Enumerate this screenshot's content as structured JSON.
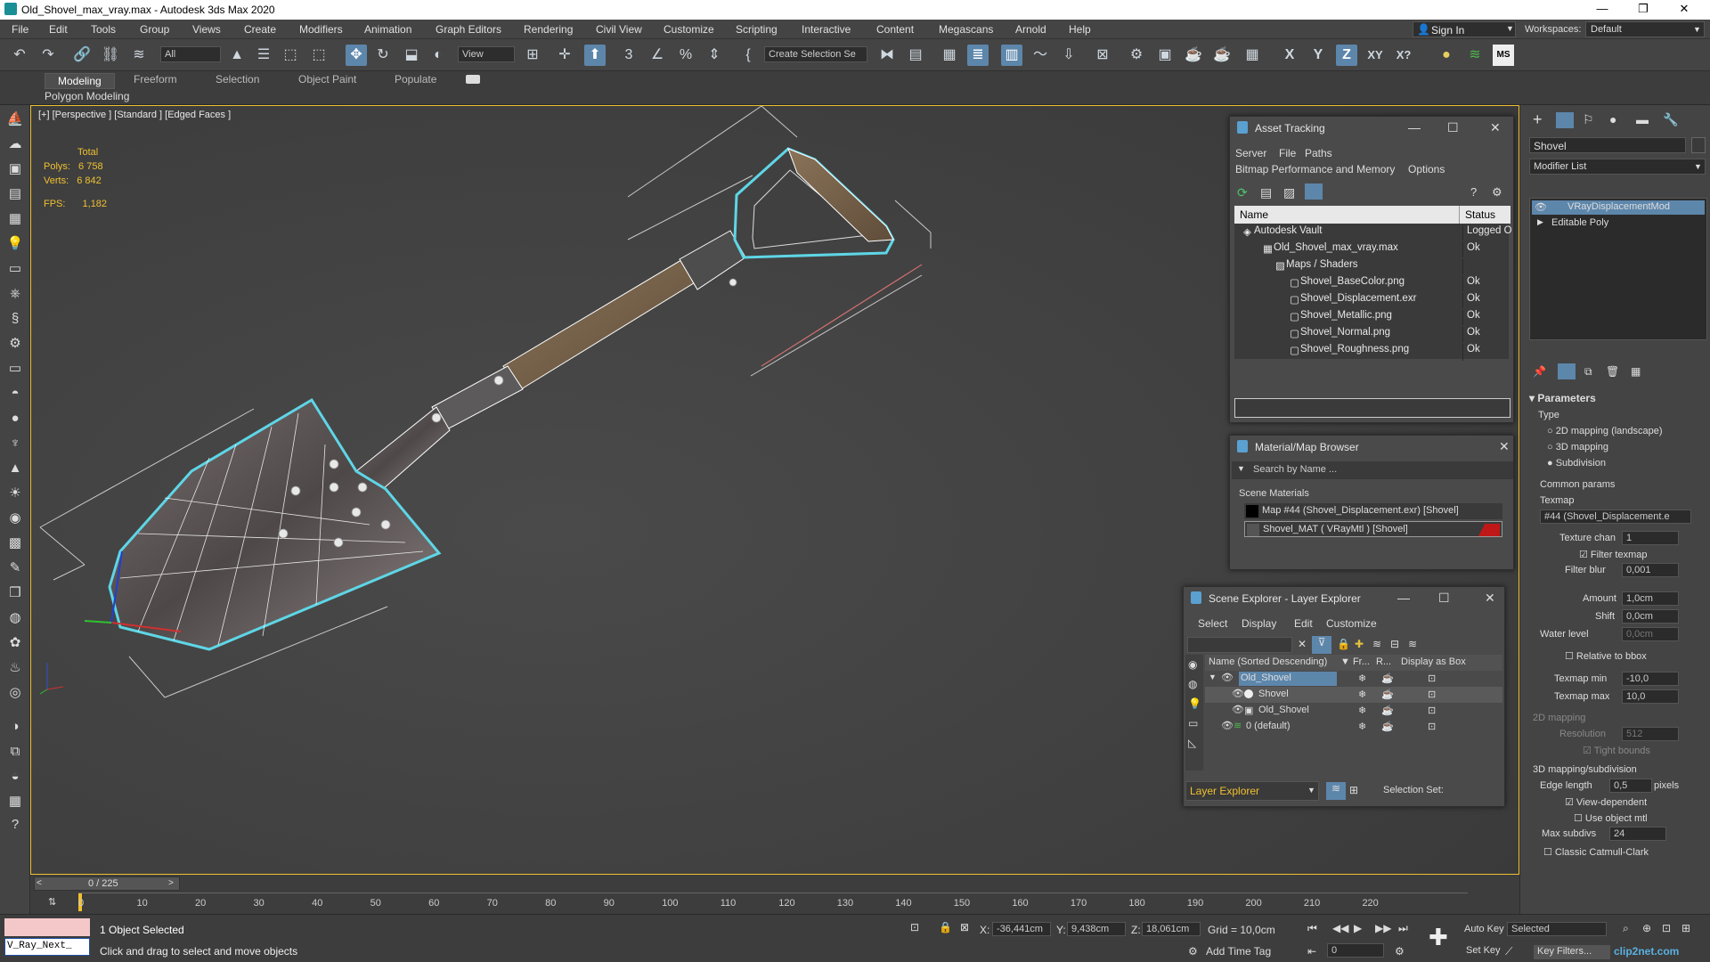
{
  "window": {
    "title": "Old_Shovel_max_vray.max - Autodesk 3ds Max 2020"
  },
  "menu": [
    "File",
    "Edit",
    "Tools",
    "Group",
    "Views",
    "Create",
    "Modifiers",
    "Animation",
    "Graph Editors",
    "Rendering",
    "Civil View",
    "Customize",
    "Scripting",
    "Interactive",
    "Content",
    "Megascans",
    "Arnold",
    "Help"
  ],
  "signin": "Sign In",
  "workspaces": {
    "label": "Workspaces:",
    "value": "Default"
  },
  "toolbar": {
    "filter": "All",
    "view": "View",
    "selection_set": "Create Selection Se",
    "axis_x": "X",
    "axis_y": "Y",
    "axis_z": "Z",
    "axis_xy": "XY",
    "axis_xq": "X?"
  },
  "ribbon": {
    "tabs": [
      "Modeling",
      "Freeform",
      "Selection",
      "Object Paint",
      "Populate"
    ],
    "sub": "Polygon Modeling"
  },
  "viewport": {
    "label": "[+] [Perspective ] [Standard ] [Edged Faces ]",
    "stats": {
      "total": "Total",
      "polys_label": "Polys:",
      "polys": "6 758",
      "verts_label": "Verts:",
      "verts": "6 842",
      "fps_label": "FPS:",
      "fps": "1,182"
    }
  },
  "asset_tracking": {
    "title": "Asset Tracking",
    "menu": [
      "Server",
      "File",
      "Paths"
    ],
    "menu2": [
      "Bitmap Performance and Memory",
      "Options"
    ],
    "cols": [
      "Name",
      "Status"
    ],
    "rows": [
      {
        "name": "Autodesk Vault",
        "status": "Logged O"
      },
      {
        "name": "Old_Shovel_max_vray.max",
        "status": "Ok"
      },
      {
        "name": "Maps / Shaders",
        "status": ""
      },
      {
        "name": "Shovel_BaseColor.png",
        "status": "Ok"
      },
      {
        "name": "Shovel_Displacement.exr",
        "status": "Ok"
      },
      {
        "name": "Shovel_Metallic.png",
        "status": "Ok"
      },
      {
        "name": "Shovel_Normal.png",
        "status": "Ok"
      },
      {
        "name": "Shovel_Roughness.png",
        "status": "Ok"
      }
    ]
  },
  "material_browser": {
    "title": "Material/Map Browser",
    "search": "Search by Name ...",
    "section": "Scene Materials",
    "items": [
      "Map #44 (Shovel_Displacement.exr) [Shovel]",
      "Shovel_MAT ( VRayMtl ) [Shovel]"
    ]
  },
  "scene_explorer": {
    "title": "Scene Explorer - Layer Explorer",
    "menu": [
      "Select",
      "Display",
      "Edit",
      "Customize"
    ],
    "cols": [
      "Name (Sorted Descending)",
      "▼ Fr...",
      "R...",
      "Display as Box"
    ],
    "rows": [
      "Old_Shovel",
      "Shovel",
      "Old_Shovel",
      "0 (default)"
    ],
    "footer": "Layer Explorer",
    "selection_set": "Selection Set:"
  },
  "command_panel": {
    "object_name": "Shovel",
    "modifier_list": "Modifier List",
    "stack": [
      "VRayDisplacementMod",
      "Editable Poly"
    ],
    "parameters": "Parameters",
    "type_label": "Type",
    "types": [
      "2D mapping (landscape)",
      "3D mapping",
      "Subdivision"
    ],
    "common": "Common params",
    "texmap_label": "Texmap",
    "texmap": "#44 (Shovel_Displacement.e",
    "texture_chan_label": "Texture chan",
    "texture_chan": "1",
    "filter_texmap": "Filter texmap",
    "filter_blur_label": "Filter blur",
    "filter_blur": "0,001",
    "amount_label": "Amount",
    "amount": "1,0cm",
    "shift_label": "Shift",
    "shift": "0,0cm",
    "water_label": "Water level",
    "water": "0,0cm",
    "relative": "Relative to bbox",
    "texmap_min_label": "Texmap min",
    "texmap_min": "-10,0",
    "texmap_max_label": "Texmap max",
    "texmap_max": "10,0",
    "mapping2d": "2D mapping",
    "resolution_label": "Resolution",
    "resolution": "512",
    "tight": "Tight bounds",
    "mapping3d": "3D mapping/subdivision",
    "edge_label": "Edge length",
    "edge": "0,5",
    "pixels": "pixels",
    "view_dep": "View-dependent",
    "use_obj": "Use object mtl",
    "max_subdivs_label": "Max subdivs",
    "max_subdivs": "24",
    "catmull": "Classic Catmull-Clark"
  },
  "timeline": {
    "frame": "0 / 225",
    "ticks": [
      "0",
      "10",
      "20",
      "30",
      "40",
      "50",
      "60",
      "70",
      "80",
      "90",
      "100",
      "110",
      "120",
      "130",
      "140",
      "150",
      "160",
      "170",
      "180",
      "190",
      "200",
      "210",
      "220"
    ]
  },
  "status": {
    "maxscript": "V_Ray_Next_",
    "selected": "1 Object Selected",
    "hint": "Click and drag to select and move objects",
    "x": "-36,441cm",
    "y": "9,438cm",
    "z": "18,061cm",
    "grid": "Grid = 10,0cm",
    "add_time_tag": "Add Time Tag",
    "auto_key": "Auto Key",
    "selected_dd": "Selected",
    "set_key": "Set Key",
    "key_filters": "Key Filters...",
    "frame_field": "0",
    "watermark": "clip2net.com"
  }
}
